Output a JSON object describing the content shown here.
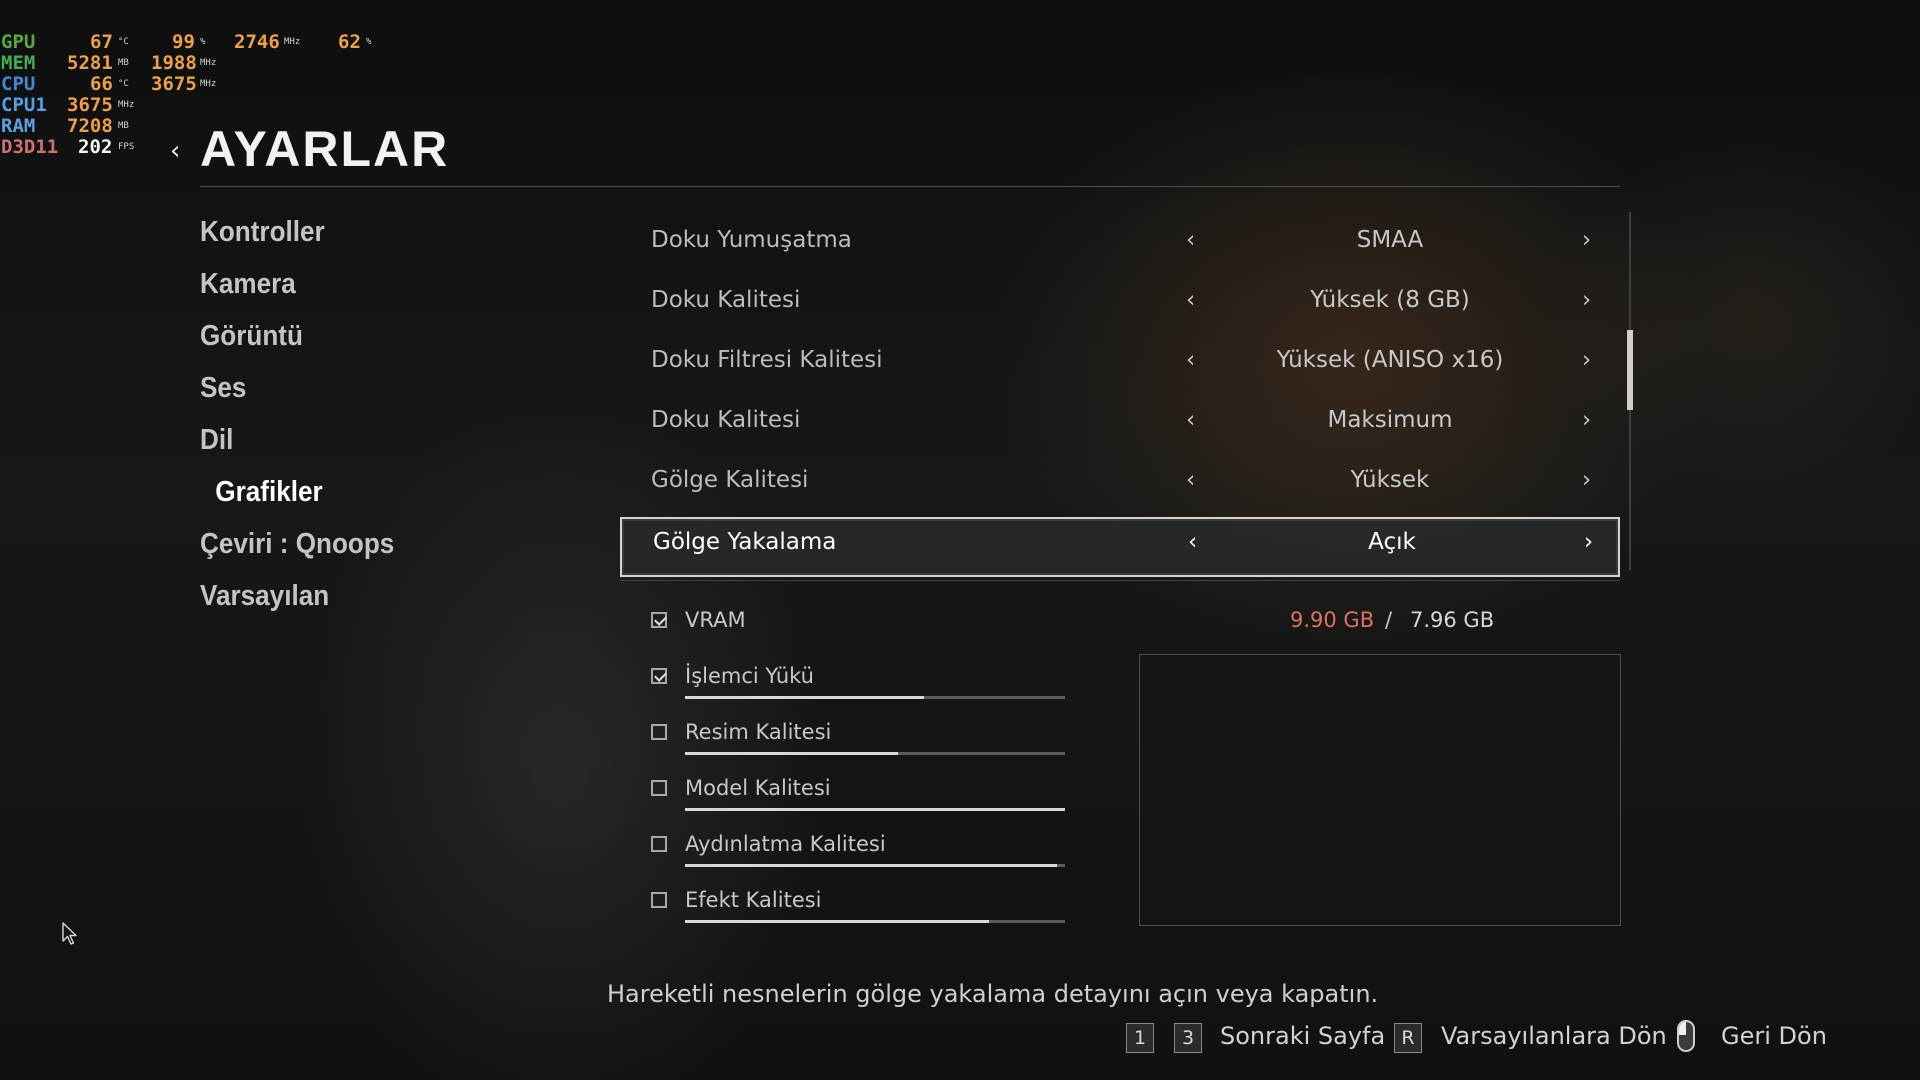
{
  "perf_overlay": {
    "gpu": {
      "label": "GPU",
      "temp": "67",
      "temp_unit": "°C",
      "load": "99",
      "load_unit": "%",
      "clock": "2746",
      "clock_unit": "MHz",
      "fan": "62",
      "fan_unit": "%"
    },
    "mem": {
      "label": "MEM",
      "used": "5281",
      "used_unit": "MB",
      "clock": "1988",
      "clock_unit": "MHz"
    },
    "cpu": {
      "label": "CPU",
      "temp": "66",
      "temp_unit": "°C",
      "clock": "3675",
      "clock_unit": "MHz"
    },
    "cpu1": {
      "label": "CPU1",
      "clock": "3675",
      "clock_unit": "MHz"
    },
    "ram": {
      "label": "RAM",
      "used": "7208",
      "used_unit": "MB"
    },
    "d3d11": {
      "label": "D3D11",
      "fps": "202",
      "fps_unit": "FPS"
    }
  },
  "header": {
    "back_icon": "‹",
    "title": "AYARLAR"
  },
  "nav": {
    "items": [
      {
        "label": "Kontroller"
      },
      {
        "label": "Kamera"
      },
      {
        "label": "Görüntü"
      },
      {
        "label": "Ses"
      },
      {
        "label": "Dil"
      },
      {
        "label": "Grafikler"
      },
      {
        "label": "Çeviri : Qnoops"
      },
      {
        "label": "Varsayılan"
      }
    ],
    "active_index": 5
  },
  "settings": [
    {
      "label": "Doku Yumuşatma",
      "value": "SMAA"
    },
    {
      "label": "Doku Kalitesi",
      "value": "Yüksek (8 GB)"
    },
    {
      "label": "Doku Filtresi Kalitesi",
      "value": "Yüksek (ANISO x16)"
    },
    {
      "label": "Doku Kalitesi",
      "value": "Maksimum"
    },
    {
      "label": "Gölge Kalitesi",
      "value": "Yüksek"
    },
    {
      "label": "Gölge Yakalama",
      "value": "Açık",
      "selected": true
    }
  ],
  "arrows": {
    "left": "‹",
    "right": "›"
  },
  "vram": {
    "label": "VRAM",
    "checked": true,
    "used": "9.90 GB",
    "separator": "/",
    "total": "7.96 GB"
  },
  "options": [
    {
      "label": "İşlemci Yükü",
      "checked": true,
      "level": 0.63
    },
    {
      "label": "Resim Kalitesi",
      "checked": false,
      "level": 0.56
    },
    {
      "label": "Model Kalitesi",
      "checked": false,
      "level": 1.0
    },
    {
      "label": "Aydınlatma Kalitesi",
      "checked": false,
      "level": 0.98
    },
    {
      "label": "Efekt Kalitesi",
      "checked": false,
      "level": 0.8
    }
  ],
  "description": "Hareketli nesnelerin gölge yakalama detayını açın veya kapatın.",
  "footer": {
    "key1": "1",
    "key2": "3",
    "next_page": "Sonraki Sayfa",
    "key_r": "R",
    "reset_defaults": "Varsayılanlara Dön",
    "back": "Geri Dön"
  },
  "colors": {
    "vram_used": "#e07060",
    "accent": "#ffffff",
    "selected_border": "#d4d4d4"
  }
}
